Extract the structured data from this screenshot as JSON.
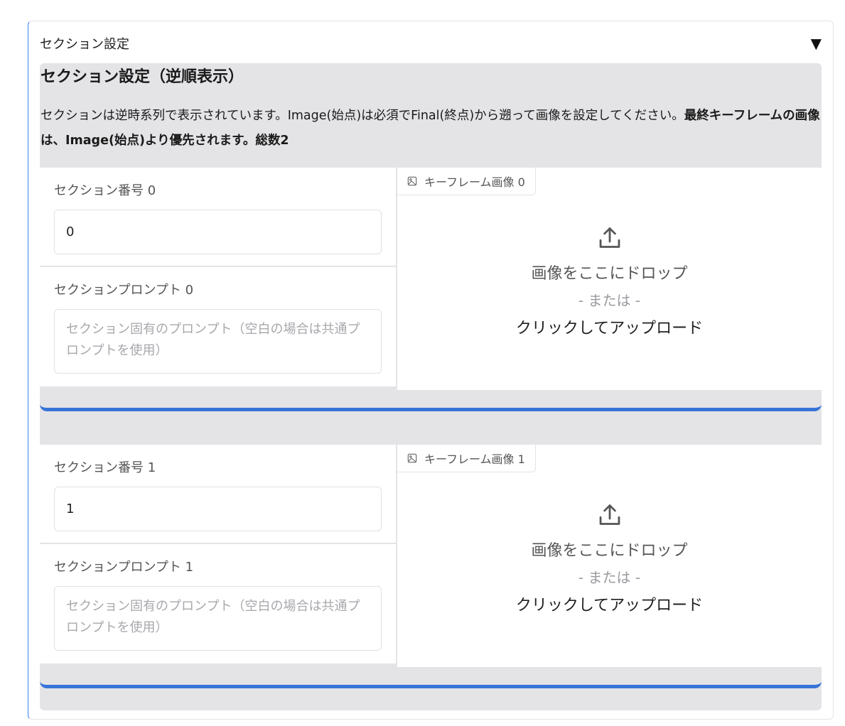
{
  "accordion": {
    "title": "セクション設定",
    "toggle_glyph": "▼"
  },
  "heading": "セクション設定（逆順表示）",
  "description": {
    "normal": "セクションは逆時系列で表示されています。Image(始点)は必須でFinal(終点)から遡って画像を設定してください。",
    "bold": "最終キーフレームの画像は、Image(始点)より優先されます。総数2"
  },
  "sections": [
    {
      "number_label": "セクション番号 0",
      "number_value": "0",
      "prompt_label": "セクションプロンプト 0",
      "prompt_placeholder": "セクション固有のプロンプト（空白の場合は共通プロンプトを使用）",
      "keyframe_label": "キーフレーム画像 0",
      "drop_text": "画像をここにドロップ",
      "or_text": "- または -",
      "click_text": "クリックしてアップロード"
    },
    {
      "number_label": "セクション番号 1",
      "number_value": "1",
      "prompt_label": "セクションプロンプト 1",
      "prompt_placeholder": "セクション固有のプロンプト（空白の場合は共通プロンプトを使用）",
      "keyframe_label": "キーフレーム画像 1",
      "drop_text": "画像をここにドロップ",
      "or_text": "- または -",
      "click_text": "クリックしてアップロード"
    }
  ],
  "colors": {
    "accent_blue": "#3774d8",
    "panel_bg": "#e4e4e7",
    "placeholder": "#a8a8ad"
  }
}
